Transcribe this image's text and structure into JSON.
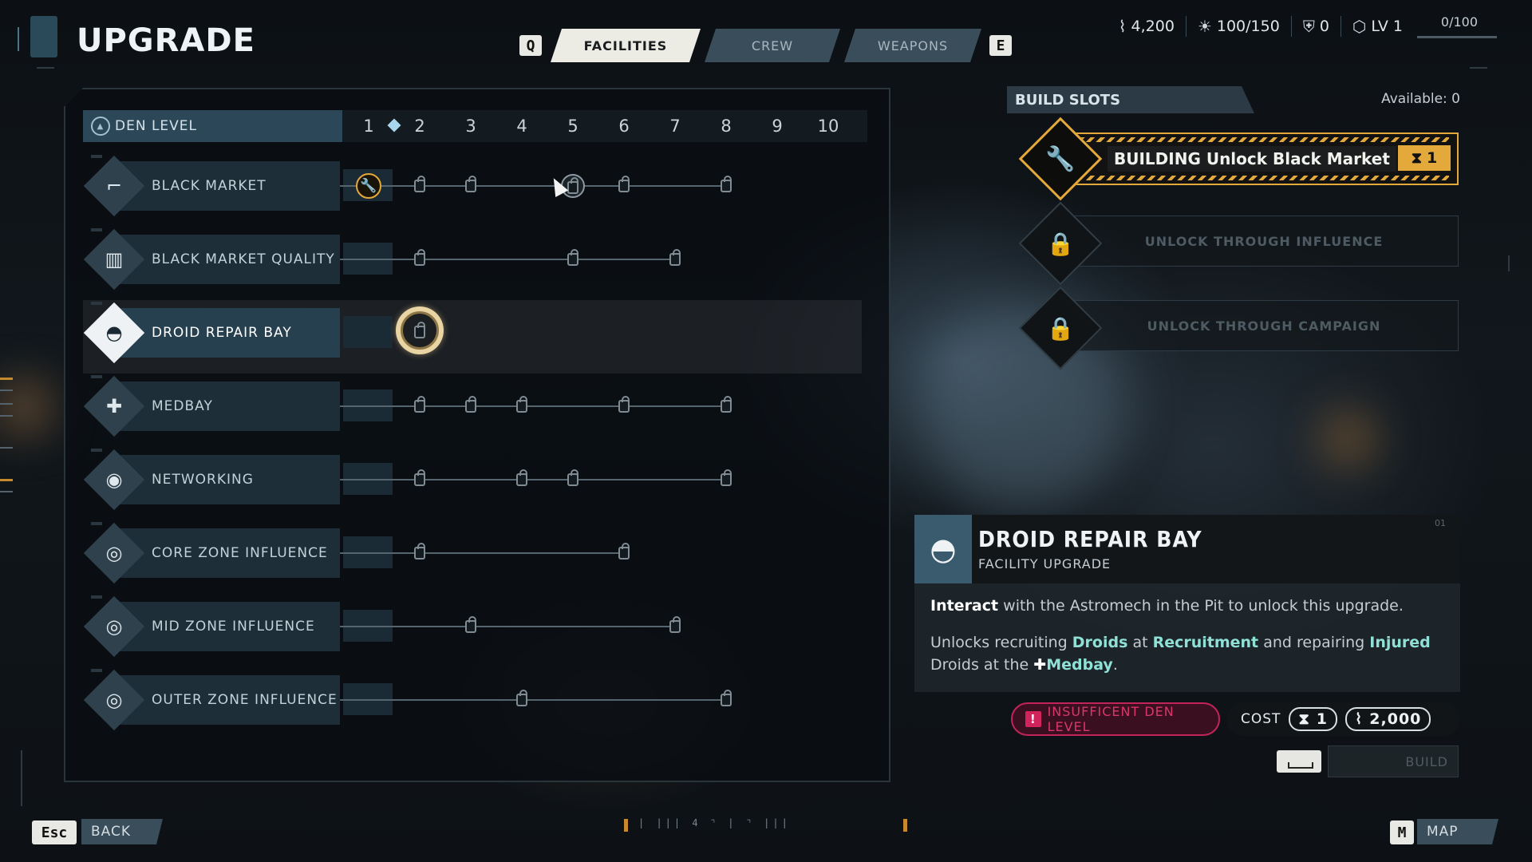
{
  "header": {
    "title": "UPGRADE",
    "key_prev": "Q",
    "key_next": "E",
    "tabs": [
      {
        "label": "FACILITIES",
        "active": true
      },
      {
        "label": "CREW",
        "active": false
      },
      {
        "label": "WEAPONS",
        "active": false
      }
    ]
  },
  "stats": {
    "credits": "4,200",
    "supplies": "100/150",
    "tokens": "0",
    "level": "LV 1",
    "xp": "0/100"
  },
  "den_level": {
    "label": "DEN LEVEL",
    "levels": [
      "1",
      "2",
      "3",
      "4",
      "5",
      "6",
      "7",
      "8",
      "9",
      "10"
    ],
    "current": 1
  },
  "facilities": [
    {
      "name": "BLACK MARKET",
      "icon": "blaster-icon"
    },
    {
      "name": "BLACK MARKET QUALITY",
      "icon": "crate-icon"
    },
    {
      "name": "DROID REPAIR BAY",
      "icon": "droid-icon",
      "selected": true
    },
    {
      "name": "MEDBAY",
      "icon": "medical-cross-icon"
    },
    {
      "name": "NETWORKING",
      "icon": "signal-icon"
    },
    {
      "name": "CORE ZONE INFLUENCE",
      "icon": "influence-icon"
    },
    {
      "name": "MID ZONE INFLUENCE",
      "icon": "influence-icon"
    },
    {
      "name": "OUTER ZONE INFLUENCE",
      "icon": "influence-icon"
    }
  ],
  "build_slots": {
    "title": "BUILD SLOTS",
    "available": "Available: 0",
    "slots": [
      {
        "text": "BUILDING Unlock Black Market",
        "timer": "1",
        "state": "building"
      },
      {
        "text": "UNLOCK THROUGH INFLUENCE",
        "state": "locked"
      },
      {
        "text": "UNLOCK THROUGH CAMPAIGN",
        "state": "locked"
      }
    ]
  },
  "detail": {
    "title": "DROID REPAIR BAY",
    "subtitle": "FACILITY UPGRADE",
    "corner": "01",
    "line1_bold": "Interact",
    "line1_rest": " with the Astromech in the Pit to unlock this upgrade.",
    "line2_a": "Unlocks recruiting ",
    "line2_droids": "Droids",
    "line2_b": " at ",
    "line2_recruitment": "Recruitment",
    "line2_c": " and repairing ",
    "line2_injured": "Injured",
    "line3_a": "Droids at the ",
    "line3_medbay": "Medbay",
    "line3_b": ".",
    "warning": "INSUFFICENT DEN LEVEL",
    "cost_label": "COST",
    "cost_time": "1",
    "cost_credits": "2,000",
    "build_label": "BUILD"
  },
  "footer": {
    "esc_key": "Esc",
    "back_label": "BACK",
    "map_key": "M",
    "map_label": "MAP",
    "ticker": "| ||| 4    ⌝   |    ⌝ |||"
  },
  "colors": {
    "accent": "#e3a93a",
    "warning": "#d9366a",
    "highlight": "#8fe0d6",
    "panel": "#1d2e39"
  }
}
